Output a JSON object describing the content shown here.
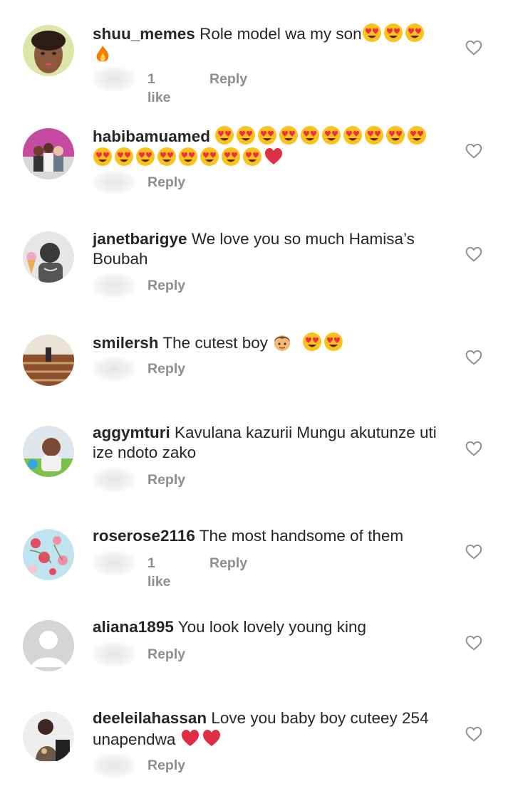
{
  "comments": [
    {
      "username": "shuu_memes",
      "text": "Role model wa my son",
      "emojis_after": [
        "heart-eyes-emoji",
        "heart-eyes-emoji",
        "heart-eyes-emoji",
        "fire-emoji"
      ],
      "likes": "1 like",
      "reply": "Reply",
      "avatar": "avatar-woman-portrait"
    },
    {
      "username": "habibamuamed",
      "text": "",
      "emojis_after": [
        "heart-eyes-emoji",
        "heart-eyes-emoji",
        "heart-eyes-emoji",
        "heart-eyes-emoji",
        "heart-eyes-emoji",
        "heart-eyes-emoji",
        "heart-eyes-emoji",
        "heart-eyes-emoji",
        "heart-eyes-emoji",
        "heart-eyes-emoji",
        "heart-eyes-emoji",
        "heart-eyes-emoji",
        "heart-eyes-emoji",
        "heart-eyes-emoji",
        "heart-eyes-emoji",
        "heart-eyes-emoji",
        "heart-eyes-emoji",
        "heart-eyes-emoji",
        "red-heart-emoji"
      ],
      "likes": "",
      "reply": "Reply",
      "avatar": "avatar-kids-group"
    },
    {
      "username": "janetbarigye",
      "text": "We love you so much Hamisa’s Boubah",
      "emojis_after": [],
      "likes": "",
      "reply": "Reply",
      "avatar": "avatar-girl-bw"
    },
    {
      "username": "smilersh",
      "text": "The cutest boy",
      "emojis_after": [
        "boy-emoji",
        "heart-eyes-emoji",
        "heart-eyes-emoji"
      ],
      "likes": "",
      "reply": "Reply",
      "avatar": "avatar-stairs-scene"
    },
    {
      "username": "aggymturi",
      "text": "Kavulana kazurii Mungu akutunze uti  ize ndoto zako",
      "emojis_after": [],
      "likes": "",
      "reply": "Reply",
      "avatar": "avatar-child-photo"
    },
    {
      "username": "roserose2116",
      "text": "The most handsome of them",
      "emojis_after": [],
      "likes": "1 like",
      "reply": "Reply",
      "avatar": "avatar-flowers"
    },
    {
      "username": "aliana1895",
      "text": "You look lovely young king",
      "emojis_after": [],
      "likes": "",
      "reply": "Reply",
      "avatar": "avatar-default"
    },
    {
      "username": "deeleilahassan",
      "text": "Love you baby boy cuteey 254 unapendwa",
      "emojis_after": [
        "red-heart-emoji",
        "red-heart-emoji"
      ],
      "likes": "",
      "reply": "Reply",
      "avatar": "avatar-woman-seated"
    }
  ],
  "icons": {
    "like": "heart-outline-icon"
  },
  "colors": {
    "meta_gray": "#8e8e8e",
    "text": "#262626"
  }
}
